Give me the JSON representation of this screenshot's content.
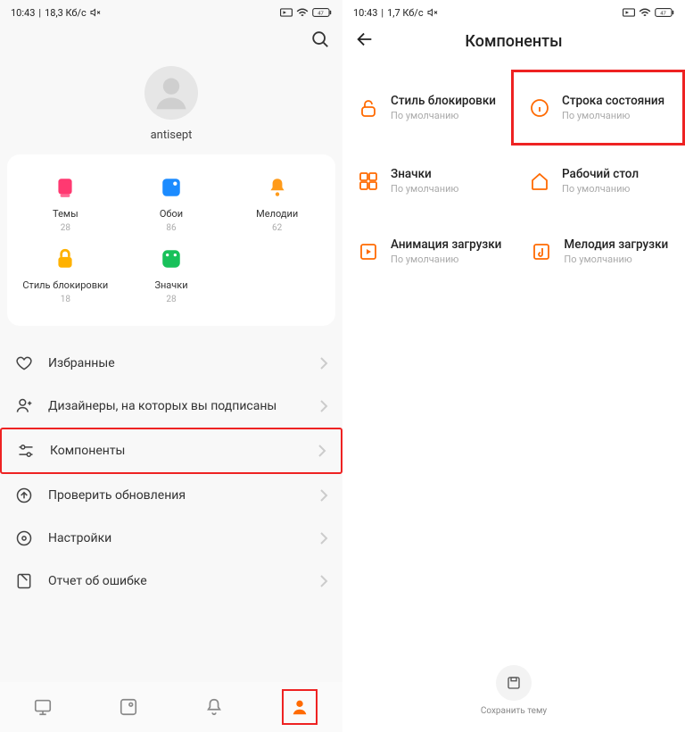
{
  "left": {
    "status": {
      "time": "10:43",
      "speed": "18,3 Кб/с"
    },
    "username": "antisept",
    "grid": [
      {
        "label": "Темы",
        "count": "28",
        "icon": "themes",
        "color": "#ff3971"
      },
      {
        "label": "Обои",
        "count": "86",
        "icon": "wallpaper",
        "color": "#1b8bff"
      },
      {
        "label": "Мелодии",
        "count": "62",
        "icon": "ringtone",
        "color": "#ff9b1a"
      },
      {
        "label": "Стиль блокировки",
        "count": "18",
        "icon": "lock",
        "color": "#ffb100"
      },
      {
        "label": "Значки",
        "count": "28",
        "icon": "icons",
        "color": "#18c15a"
      }
    ],
    "menu": [
      {
        "label": "Избранные",
        "icon": "heart"
      },
      {
        "label": "Дизайнеры, на которых вы подписаны",
        "icon": "person"
      },
      {
        "label": "Компоненты",
        "icon": "sliders",
        "highlight": true
      },
      {
        "label": "Проверить обновления",
        "icon": "update"
      },
      {
        "label": "Настройки",
        "icon": "gear"
      },
      {
        "label": "Отчет об ошибке",
        "icon": "report"
      }
    ]
  },
  "right": {
    "status": {
      "time": "10:43",
      "speed": "1,7 Кб/с"
    },
    "title": "Компоненты",
    "default_text": "По умолчанию",
    "items": [
      {
        "label": "Стиль блокировки",
        "icon": "lock-o"
      },
      {
        "label": "Строка состояния",
        "icon": "info-o",
        "highlight": true
      },
      {
        "label": "Значки",
        "icon": "grid-o"
      },
      {
        "label": "Рабочий стол",
        "icon": "home-o"
      },
      {
        "label": "Анимация загрузки",
        "icon": "anim-o"
      },
      {
        "label": "Мелодия загрузки",
        "icon": "note-o"
      }
    ],
    "save_label": "Сохранить тему"
  }
}
